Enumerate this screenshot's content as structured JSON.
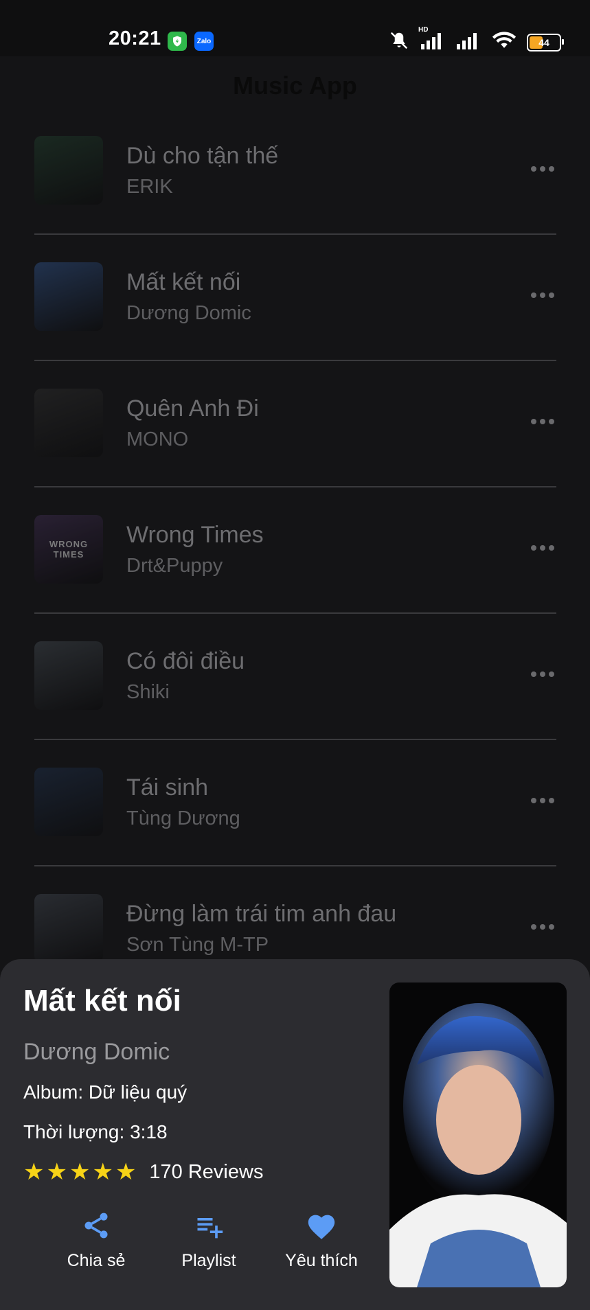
{
  "status_bar": {
    "time": "20:21",
    "battery": "44",
    "network_label": "HD",
    "apps": [
      {
        "name": "shield-app-icon",
        "color": "#2fb84b"
      },
      {
        "name": "zalo-app-icon",
        "label": "Zalo",
        "color": "#0a68ff"
      }
    ]
  },
  "header": {
    "title": "Music App"
  },
  "songs": [
    {
      "title": "Dù cho tận thế",
      "artist": "ERIK",
      "thumb_color": "#1f3a2a"
    },
    {
      "title": "Mất kết nối",
      "artist": "Dương Domic",
      "thumb_color": "#2c4a7a"
    },
    {
      "title": "Quên Anh Đi",
      "artist": "MONO",
      "thumb_color": "#2a2a2a"
    },
    {
      "title": "Wrong Times",
      "artist": "Drt&Puppy",
      "thumb_color": "#3a2a4a",
      "thumb_text": "WRONG TIMES"
    },
    {
      "title": "Có đôi điều",
      "artist": "Shiki",
      "thumb_color": "#3c4248"
    },
    {
      "title": "Tái sinh",
      "artist": "Tùng Dương",
      "thumb_color": "#1d2c44"
    },
    {
      "title": "Đừng làm trái tim anh đau",
      "artist": "Sơn Tùng M-TP",
      "thumb_color": "#3a3f47"
    }
  ],
  "detail": {
    "title": "Mất kết nối",
    "artist": "Dương Domic",
    "album": "Album: Dữ liệu quý",
    "duration": "Thời lượng: 3:18",
    "rating": 5,
    "reviews": "170 Reviews",
    "actions": {
      "share": "Chia sẻ",
      "playlist": "Playlist",
      "favorite": "Yêu thích"
    },
    "accent_color": "#5c9cf5",
    "star_color": "#f7d317"
  }
}
